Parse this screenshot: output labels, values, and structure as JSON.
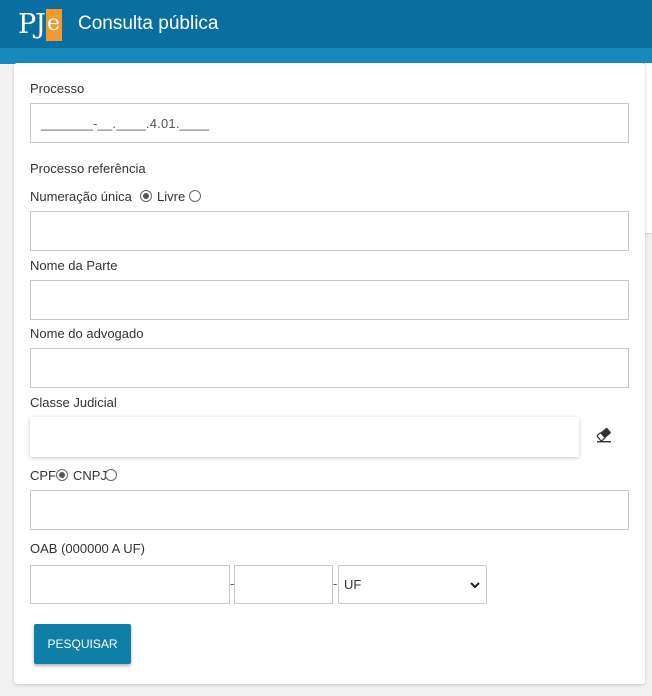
{
  "header": {
    "logo": "PJe",
    "title": "Consulta pública"
  },
  "form": {
    "processo": {
      "label": "Processo",
      "mask": "_______-__.____.4.01.____"
    },
    "processo_referencia": {
      "label": "Processo referência",
      "option_unica": "Numeração única",
      "option_livre": "Livre",
      "selected": "Numeração única",
      "value": ""
    },
    "nome_parte": {
      "label": "Nome da Parte",
      "value": ""
    },
    "nome_advogado": {
      "label": "Nome do advogado",
      "value": ""
    },
    "classe_judicial": {
      "label": "Classe Judicial",
      "value": "",
      "clear_icon": "eraser-icon"
    },
    "documento": {
      "option_cpf": "CPF",
      "option_cnpj": "CNPJ",
      "selected": "CPF",
      "value": ""
    },
    "oab": {
      "label": "OAB (000000 A UF)",
      "number": "",
      "letter": "",
      "separator": "-",
      "uf_selected": "UF"
    },
    "search_button": "PESQUISAR"
  }
}
